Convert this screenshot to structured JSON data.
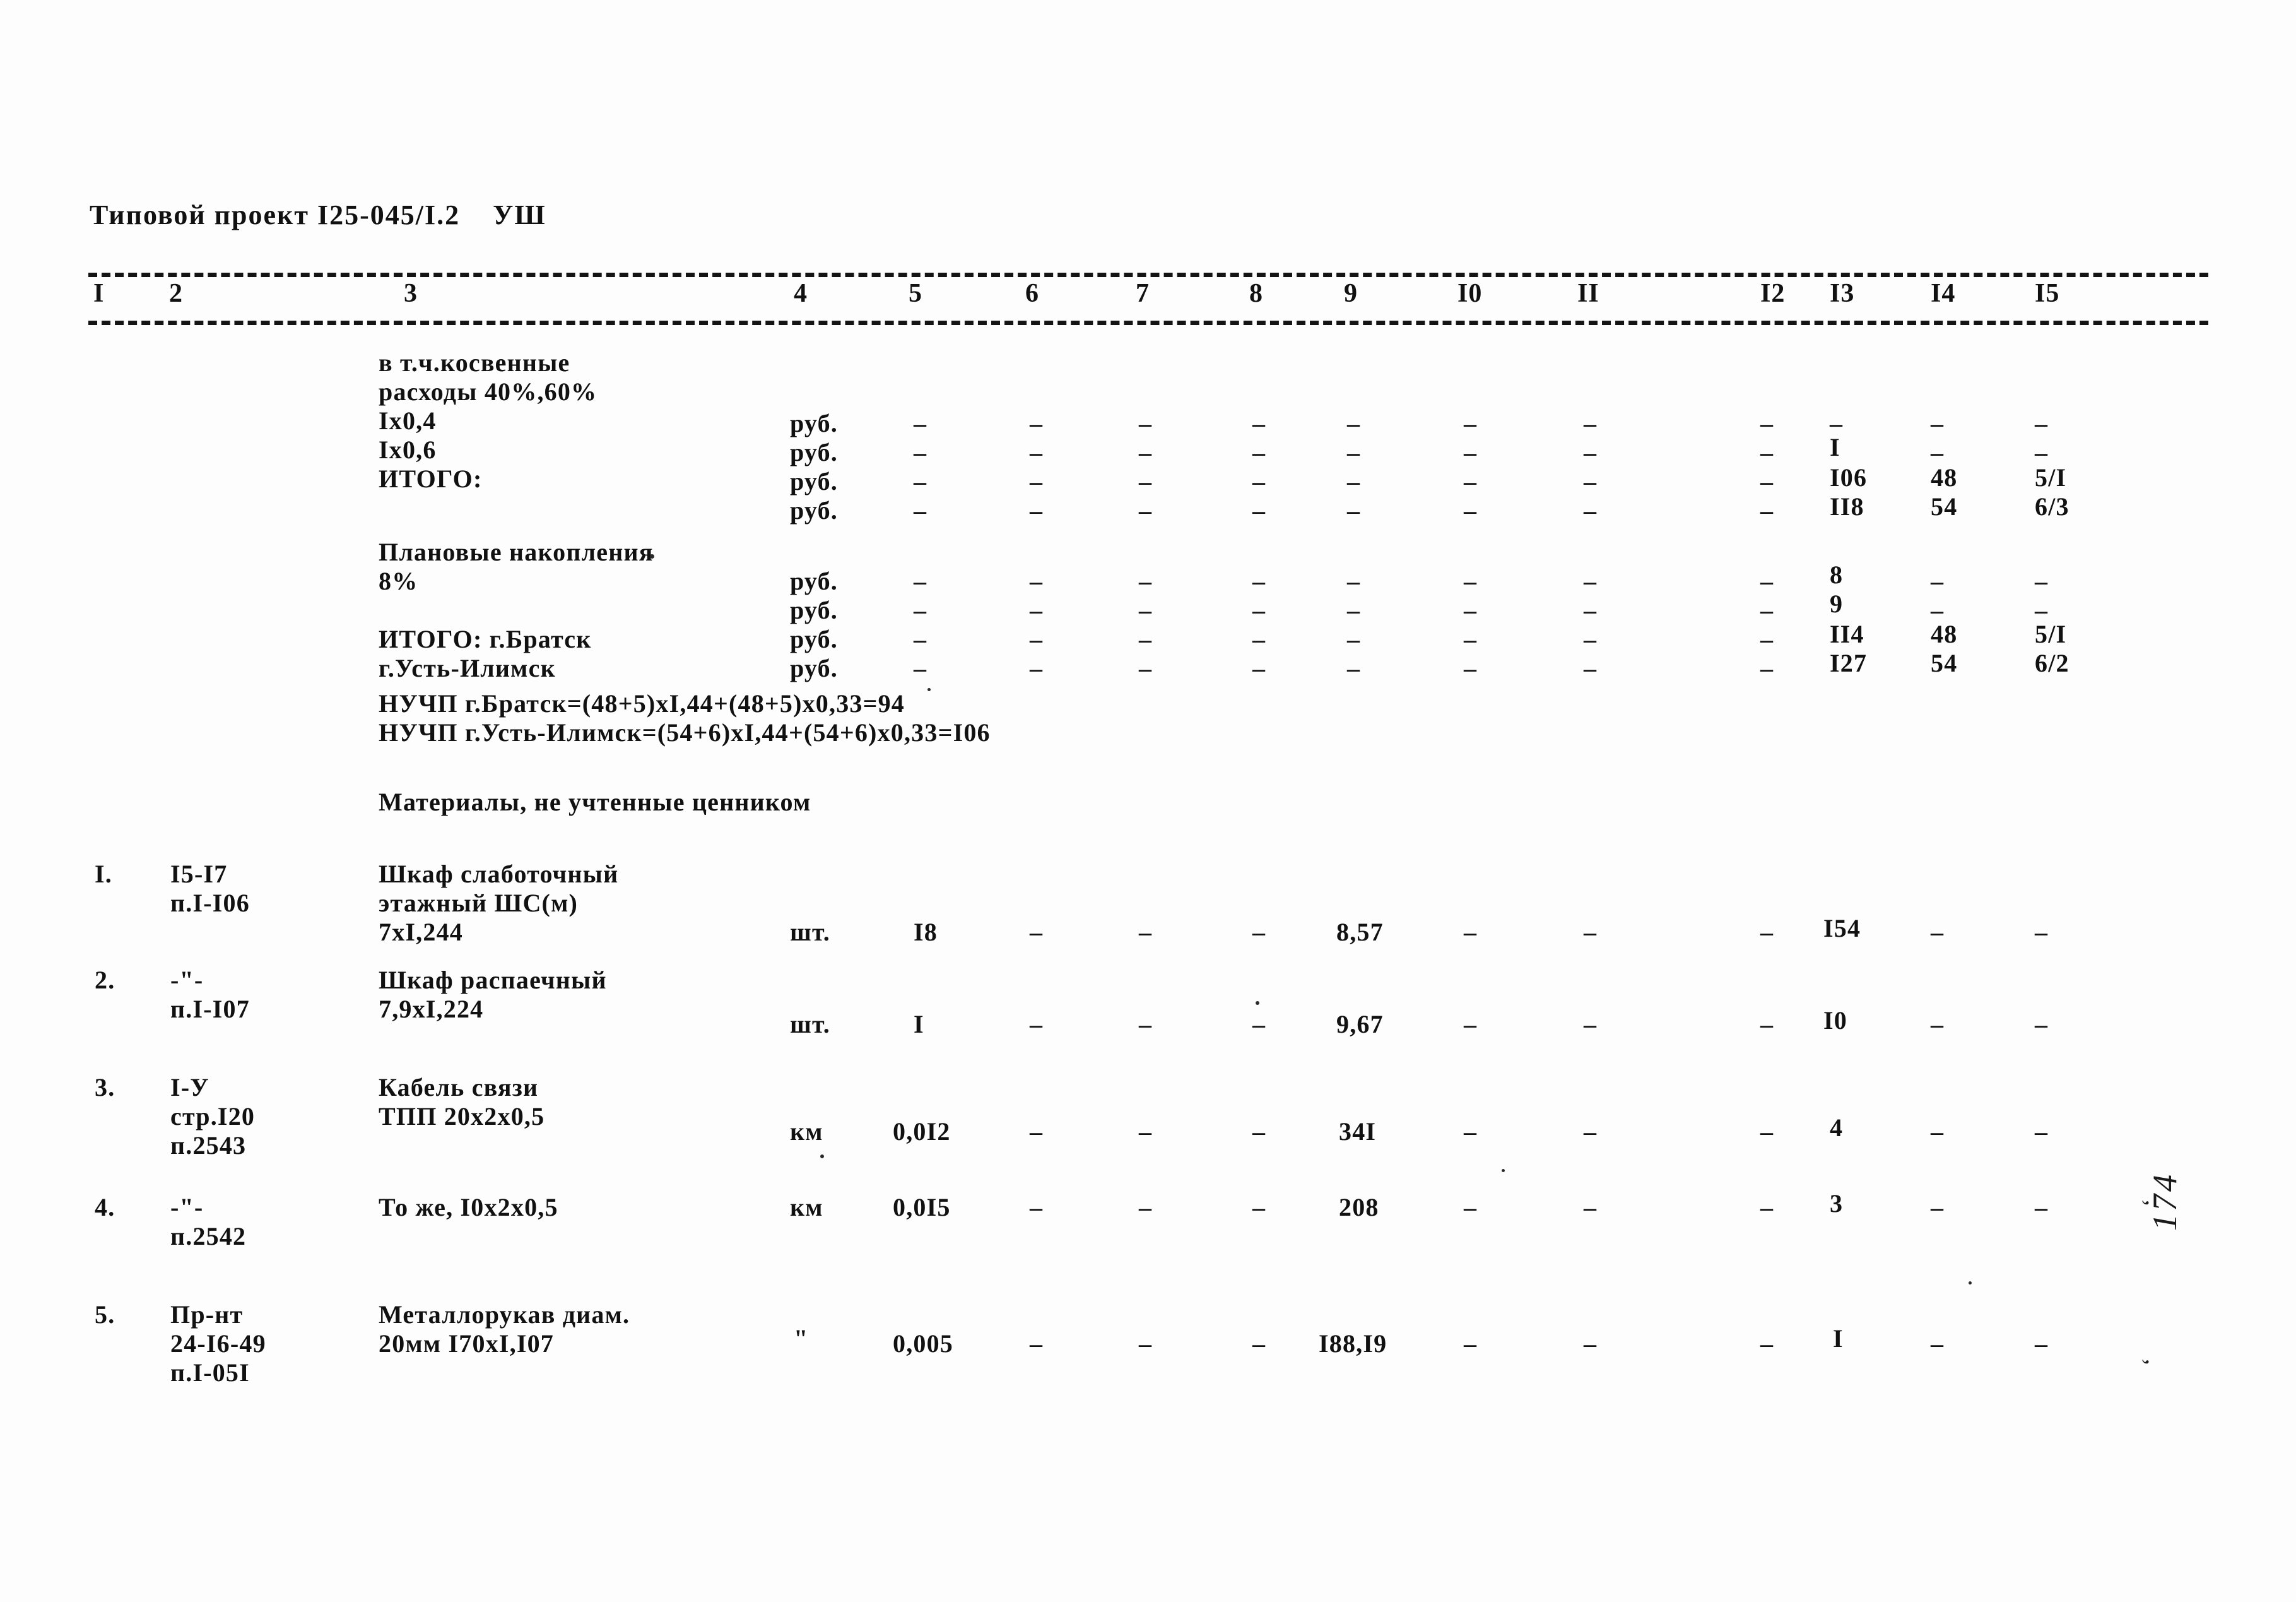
{
  "document": {
    "title": "Типовой проект I25-045/I.2    УШ",
    "page_folio": "174",
    "folio_tick": "‘"
  },
  "table": {
    "column_numbers": [
      "I",
      "2",
      "3",
      "4",
      "5",
      "6",
      "7",
      "8",
      "9",
      "I0",
      "II",
      "I2",
      "I3",
      "I4",
      "I5"
    ],
    "column_x": [
      148,
      268,
      640,
      1258,
      1440,
      1625,
      1800,
      1980,
      2130,
      2330,
      2510,
      2790,
      2900,
      3060,
      3230
    ],
    "dash": "–"
  },
  "overhead_block": {
    "lines": [
      "в т.ч.косвенные",
      "расходы 40%,60%",
      "Iх0,4",
      "Iх0,6",
      "ИТОГО:"
    ],
    "rows": [
      {
        "unit": "руб.",
        "dashes": [
          "–",
          "–",
          "–",
          "–",
          "–",
          "–",
          "–",
          "–",
          "–"
        ],
        "c13": "–",
        "c14": "–",
        "c15": "–"
      },
      {
        "unit": "руб.",
        "dashes": [
          "–",
          "–",
          "–",
          "–",
          "–",
          "–",
          "–",
          "–",
          "–"
        ],
        "c13": "I",
        "c14": "–",
        "c15": "–"
      },
      {
        "unit": "руб.",
        "dashes": [
          "–",
          "–",
          "–",
          "–",
          "–",
          "–",
          "–",
          "–",
          "–"
        ],
        "c13": "I06",
        "c14": "48",
        "c15": "5/I"
      },
      {
        "unit": "руб.",
        "dashes": [
          "–",
          "–",
          "–",
          "–",
          "–",
          "–",
          "–",
          "–",
          "–"
        ],
        "c13": "II8",
        "c14": "54",
        "c15": "6/3"
      }
    ]
  },
  "planned_savings_block": {
    "heading": "Плановые накопления",
    "percent": "8%",
    "total_bratsk": "ИТОГО: г.Братск",
    "total_ust_ilimsk": "г.Усть-Илимск",
    "rows": [
      {
        "unit": "руб.",
        "c13": "8",
        "c14": "–",
        "c15": "–"
      },
      {
        "unit": "руб.",
        "c13": "9",
        "c14": "–",
        "c15": "–"
      },
      {
        "unit": "руб.",
        "c13": "II4",
        "c14": "48",
        "c15": "5/I"
      },
      {
        "unit": "руб.",
        "c13": "I27",
        "c14": "54",
        "c15": "6/2"
      }
    ]
  },
  "formulas": [
    "НУЧП г.Братск=(48+5)хI,44+(48+5)х0,33=94",
    "НУЧП г.Усть-Илимск=(54+6)хI,44+(54+6)х0,33=I06"
  ],
  "section_heading": "Материалы, не учтенные ценником",
  "items": [
    {
      "no": "I.",
      "code_lines": [
        "I5-I7",
        "п.I-I06"
      ],
      "name_lines": [
        "Шкаф слаботочный",
        "этажный ШС(м)",
        "7хI,244"
      ],
      "unit": "шт.",
      "c5": "I8",
      "c6": "–",
      "c7": "–",
      "c8": "–",
      "c9": "8,57",
      "c10": "–",
      "c11": "–",
      "c12": "–",
      "c13": "I54",
      "c14": "–",
      "c15": "–"
    },
    {
      "no": "2.",
      "code_lines": [
        "-\"-",
        "п.I-I07"
      ],
      "name_lines": [
        "Шкаф распаечный",
        "7,9хI,224"
      ],
      "unit": "шт.",
      "c5": "I",
      "c6": "–",
      "c7": "–",
      "c8": "–",
      "c9": "9,67",
      "c10": "–",
      "c11": "–",
      "c12": "–",
      "c13": "I0",
      "c14": "–",
      "c15": "–"
    },
    {
      "no": "3.",
      "code_lines": [
        "I-У",
        "стр.I20",
        "п.2543"
      ],
      "name_lines": [
        "Кабель связи",
        "ТПП 20х2х0,5"
      ],
      "unit": "км",
      "c5": "0,0I2",
      "c6": "–",
      "c7": "–",
      "c8": "–",
      "c9": "34I",
      "c10": "–",
      "c11": "–",
      "c12": "–",
      "c13": "4",
      "c14": "–",
      "c15": "–"
    },
    {
      "no": "4.",
      "code_lines": [
        "-\"-",
        "п.2542"
      ],
      "name_lines": [
        "То же, I0х2х0,5"
      ],
      "unit": "км",
      "c5": "0,0I5",
      "c6": "–",
      "c7": "–",
      "c8": "–",
      "c9": "208",
      "c10": "–",
      "c11": "–",
      "c12": "–",
      "c13": "3",
      "c14": "–",
      "c15": "–"
    },
    {
      "no": "5.",
      "code_lines": [
        "Пр-нт",
        "24-I6-49",
        "п.I-05I"
      ],
      "name_lines": [
        "Металлорукав диам.",
        "20мм I70хI,I07"
      ],
      "unit": "\"",
      "c5": "0,005",
      "c6": "–",
      "c7": "–",
      "c8": "–",
      "c9": "I88,I9",
      "c10": "–",
      "c11": "–",
      "c12": "–",
      "c13": "I",
      "c14": "–",
      "c15": "–"
    }
  ]
}
